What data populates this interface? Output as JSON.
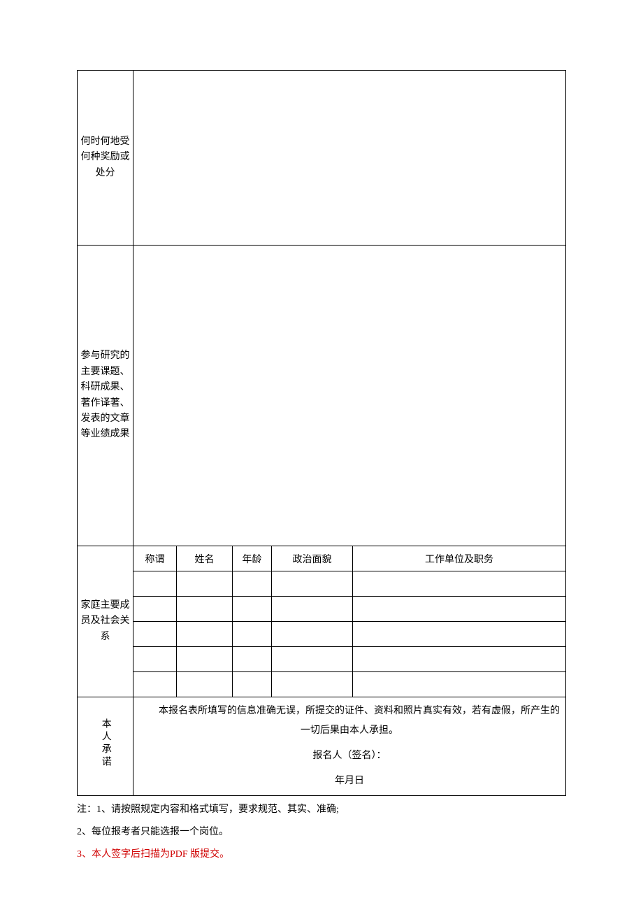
{
  "rows": {
    "awards_label": "何时何地受何种奖励或处分",
    "awards_value": "",
    "research_label": "参与研究的主要课题、科研成果、著作译著、发表的文章等业绩成果",
    "research_value": "",
    "family_label": "家庭主要成员及社会关系",
    "declaration_label": "本人承诺"
  },
  "family": {
    "headers": {
      "relation": "称谓",
      "name": "姓名",
      "age": "年龄",
      "political": "政治面貌",
      "workunit": "工作单位及职务"
    },
    "members": [
      {
        "relation": "",
        "name": "",
        "age": "",
        "political": "",
        "workunit": ""
      },
      {
        "relation": "",
        "name": "",
        "age": "",
        "political": "",
        "workunit": ""
      },
      {
        "relation": "",
        "name": "",
        "age": "",
        "political": "",
        "workunit": ""
      },
      {
        "relation": "",
        "name": "",
        "age": "",
        "political": "",
        "workunit": ""
      },
      {
        "relation": "",
        "name": "",
        "age": "",
        "political": "",
        "workunit": ""
      }
    ]
  },
  "declaration": {
    "text": "本报名表所填写的信息准确无误，所提交的证件、资料和照片真实有效，若有虚假，所产生的一切后果由本人承担。",
    "sign_label": "报名人（签名）：",
    "date_label": "年月日"
  },
  "notes": {
    "prefix": "注：",
    "n1": "1、请按照规定内容和格式填写，要求规范、其实、准确;",
    "n2": "2、每位报考者只能选报一个岗位。",
    "n3": "3、本人签字后扫描为PDF 版提交。"
  }
}
